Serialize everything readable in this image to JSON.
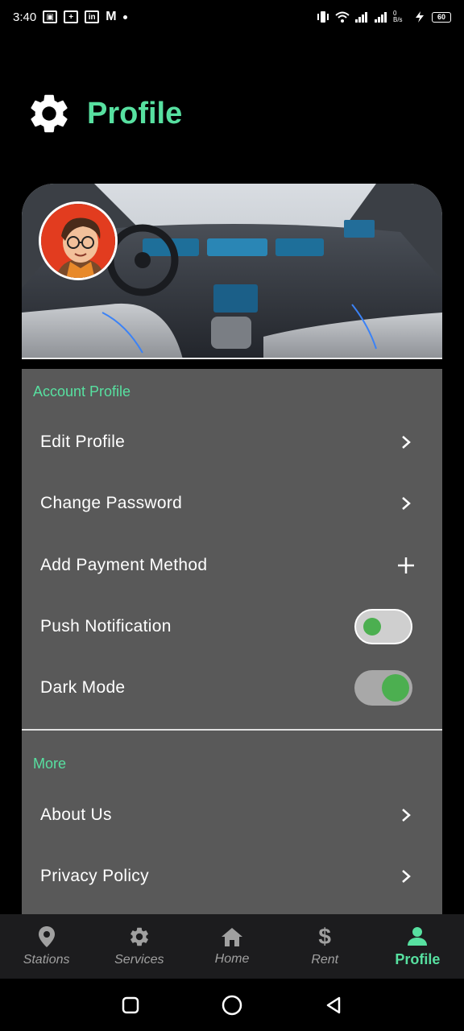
{
  "status_bar": {
    "time": "3:40",
    "battery": "60",
    "network_speed": "0 B/s"
  },
  "header": {
    "title": "Profile",
    "icon": "gear-icon"
  },
  "sections": {
    "account": {
      "title": "Account Profile",
      "items": [
        {
          "label": "Edit Profile",
          "trailing": "chevron-right-icon"
        },
        {
          "label": "Change Password",
          "trailing": "chevron-right-icon"
        },
        {
          "label": "Add Payment Method",
          "trailing": "plus-icon"
        },
        {
          "label": "Push Notification",
          "trailing": "toggle",
          "on": false
        },
        {
          "label": "Dark Mode",
          "trailing": "toggle",
          "on": true
        }
      ]
    },
    "more": {
      "title": "More",
      "items": [
        {
          "label": "About Us",
          "trailing": "chevron-right-icon"
        },
        {
          "label": "Privacy Policy",
          "trailing": "chevron-right-icon"
        }
      ]
    }
  },
  "bottom_nav": {
    "items": [
      {
        "label": "Stations",
        "icon": "location-pin-icon"
      },
      {
        "label": "Services",
        "icon": "gear-icon"
      },
      {
        "label": "Home",
        "icon": "home-icon"
      },
      {
        "label": "Rent",
        "icon": "dollar-icon"
      },
      {
        "label": "Profile",
        "icon": "person-icon",
        "active": true
      }
    ]
  },
  "colors": {
    "accent": "#57e0a0",
    "card": "#595959",
    "toggle_knob": "#4caf50",
    "nav_bg": "#1c1c1e"
  }
}
